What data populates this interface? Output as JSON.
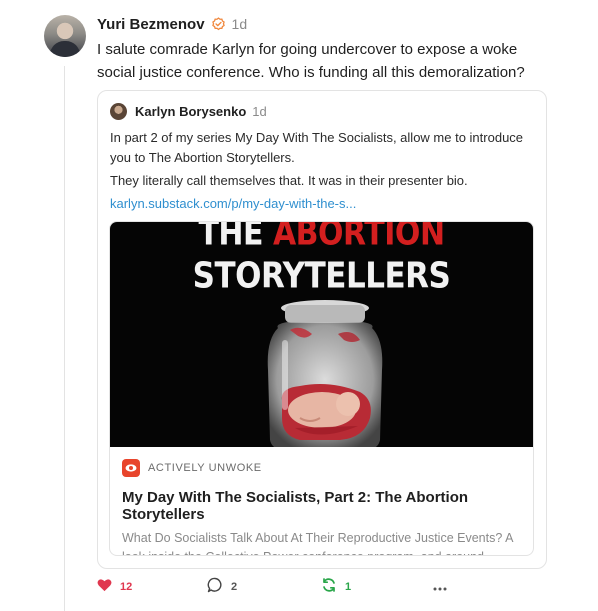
{
  "post": {
    "author": "Yuri Bezmenov",
    "time": "1d",
    "text": "I salute comrade Karlyn for going undercover to expose a woke social justice conference. Who is funding all this demoralization?"
  },
  "quote": {
    "author": "Karlyn Borysenko",
    "time": "1d",
    "paragraph1": "In part 2 of my series My Day With The Socialists, allow me to introduce you to The Abortion Storytellers.",
    "paragraph2": "They literally call themselves that. It was in their presenter bio.",
    "link": "karlyn.substack.com/p/my-day-with-the-s..."
  },
  "embed": {
    "image_title_word1": "THE",
    "image_title_word2": "ABORTION",
    "image_title_line2": "STORYTELLERS",
    "publication": "ACTIVELY UNWOKE",
    "title": "My Day With The Socialists, Part 2: The Abortion Storytellers",
    "subtitle": "What Do Socialists Talk About At Their Reproductive Justice Events? A look inside the Collective Power conference program, and around..."
  },
  "actions": {
    "likes": "12",
    "comments": "2",
    "restacks": "1"
  },
  "colors": {
    "like": "#e0374f",
    "restack": "#2aa64a",
    "link": "#2f8fcf",
    "verified": "#f0883e"
  },
  "icons": [
    "verified-icon",
    "heart-icon",
    "comment-icon",
    "restack-icon",
    "more-icon",
    "publication-logo-icon"
  ]
}
